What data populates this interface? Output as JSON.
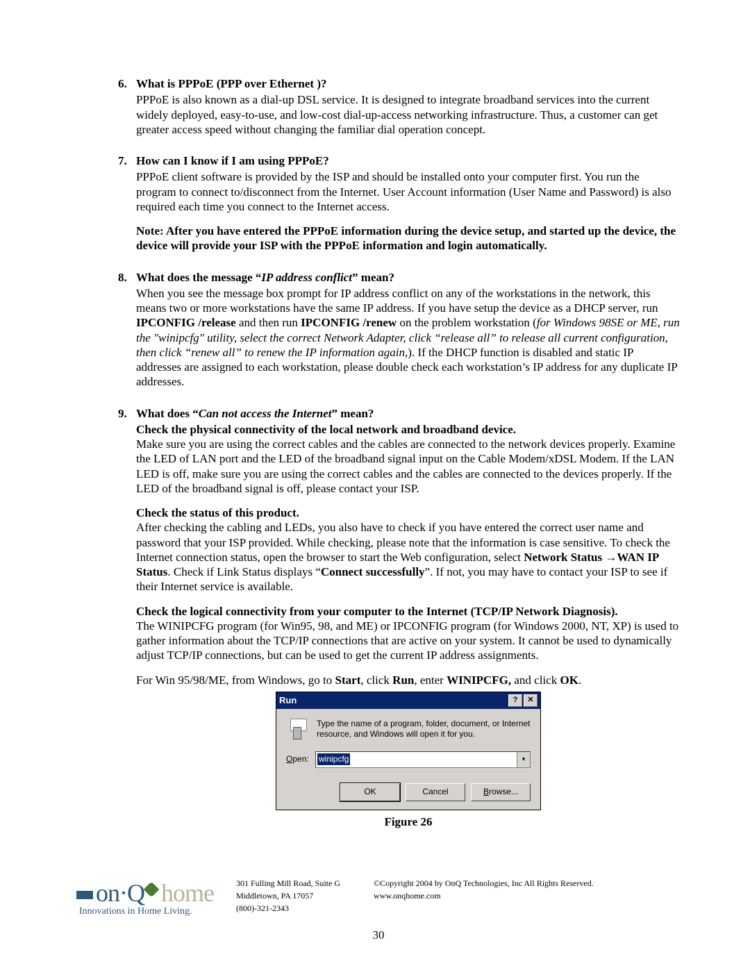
{
  "items": [
    {
      "num": "6.",
      "title_html": "What is PPPoE (PPP over Ethernet )?",
      "paras": [
        {
          "html": "PPPoE is also known as a dial-up DSL service. It is designed to integrate broadband services into the current widely deployed, easy-to-use, and low-cost dial-up-access networking infrastructure. Thus, a customer can get greater access speed without changing the familiar dial operation concept."
        }
      ]
    },
    {
      "num": "7.",
      "title_html": "How can I know if I am using PPPoE?",
      "paras": [
        {
          "html": "PPPoE client software is provided by the ISP and should be installed onto your computer first. You run the program to connect to/disconnect from the Internet. User Account information (User Name and Password) is also required each time you connect to the Internet access."
        },
        {
          "html": "<span class=\"bold\">Note: After you have entered the PPPoE information during the device setup, and started up the device, the device will provide your ISP with the PPPoE information and login automatically.</span>"
        }
      ]
    },
    {
      "num": "8.",
      "title_html": "What does the message “<span class=\"bolditalic\">IP address conflict</span>” mean?",
      "paras": [
        {
          "html": "When you see the message box prompt for IP address conflict on any of the workstations in the network, this means two or more workstations have the same IP address. If you have setup the device as a DHCP server, run <span class=\"bold\">IPCONFIG /release</span> and then run <span class=\"bold\">IPCONFIG /renew</span> on the problem workstation (<span class=\"italic\">for Windows 98SE or ME, run the &quot;winipcfg&quot; utility, select the correct Network Adapter, click &ldquo;release all&rdquo; to release all current configuration, then click &ldquo;renew all&rdquo; to renew the IP information again,</span>). If the DHCP function is disabled and static IP addresses are assigned to each workstation, please double check each workstation&rsquo;s IP address for any duplicate IP addresses."
        }
      ]
    },
    {
      "num": "9.",
      "title_html": "What does “<span class=\"bolditalic\">Can not access the Internet</span>” mean?",
      "paras": [
        {
          "html": "<span class=\"bold\">Check the physical connectivity of the local network and broadband device.</span><br>Make sure you are using the correct cables and the cables are connected to the network devices properly. Examine the LED of LAN port and the LED of the broadband signal input on the Cable Modem/xDSL Modem.  If the LAN LED is off, make sure you are using the correct cables and the cables are connected to the devices properly. If the LED of the broadband signal is off, please contact your ISP."
        },
        {
          "html": "<span class=\"bold\">Check the status of this product.</span><br>After checking the cabling and LEDs, you also have to check if you have entered the correct user name and password that your ISP provided. While checking, please note that the information is case sensitive. To check the Internet connection status, open the browser to start the Web configuration, select <span class=\"bold\">Network Status</span> &rarr;<span class=\"bold\">WAN IP Status</span>. Check if Link Status displays &ldquo;<span class=\"bold\">Connect successfully</span>&rdquo;. If not, you may have to contact your ISP to see if their Internet service is available."
        },
        {
          "html": "<span class=\"bold\">Check the logical connectivity from your computer to the Internet (TCP/IP Network Diagnosis).</span><br>The WINIPCFG program (for Win95, 98, and ME) or IPCONFIG program (for Windows 2000, NT, XP) is used to gather information about the TCP/IP connections that are active on your system. It cannot be used to dynamically adjust TCP/IP connections, but can be used to get the current IP address assignments."
        },
        {
          "html": "For Win 95/98/ME, from Windows, go to <span class=\"bold\">Start</span>, click <span class=\"bold\">Run</span>, enter <span class=\"bold\">WINIPCFG,</span> and click <span class=\"bold\">OK</span>."
        }
      ]
    }
  ],
  "run_dialog": {
    "title": "Run",
    "help_glyph": "?",
    "close_glyph": "✕",
    "description": "Type the name of a program, folder, document, or Internet resource, and Windows will open it for you.",
    "open_label_prefix_u": "O",
    "open_label_rest": "pen:",
    "input_value": "winipcfg",
    "dropdown_glyph": "▾",
    "btn_ok": "OK",
    "btn_cancel": "Cancel",
    "btn_browse_u": "B",
    "btn_browse_rest": "rowse..."
  },
  "figure_caption": "Figure 26",
  "footer": {
    "logo_on": "on·Q",
    "logo_home": "home",
    "logo_tagline": "Innovations in Home Living.",
    "addr1": "301 Fulling Mill Road, Suite G",
    "addr2": "Middletown, PA   17057",
    "addr_phone": "(800)-321-2343",
    "copyright": "©Copyright 2004 by OnQ Technologies, Inc All Rights Reserved.",
    "website": "www.onqhome.com"
  },
  "page_number": "30"
}
